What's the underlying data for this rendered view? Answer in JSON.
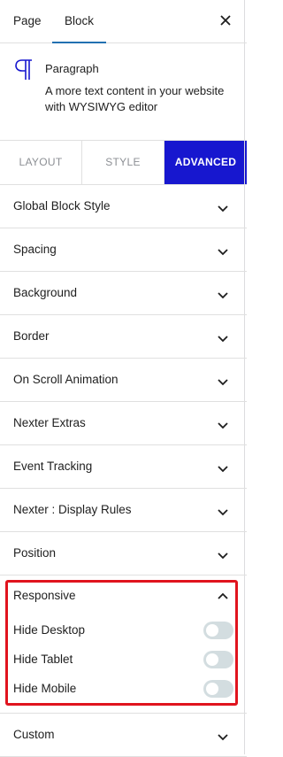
{
  "header": {
    "tab_page": "Page",
    "tab_block": "Block",
    "close_icon": "close-icon"
  },
  "block": {
    "icon": "paragraph-icon",
    "title": "Paragraph",
    "description": "A more text content in your website with WYSIWYG editor"
  },
  "modes": {
    "layout": "LAYOUT",
    "style": "STYLE",
    "advanced": "ADVANCED",
    "active": "ADVANCED"
  },
  "panels": [
    "Global Block Style",
    "Spacing",
    "Background",
    "Border",
    "On Scroll Animation",
    "Nexter Extras",
    "Event Tracking",
    "Nexter : Display Rules",
    "Position"
  ],
  "responsive": {
    "title": "Responsive",
    "toggles": [
      {
        "label": "Hide Desktop",
        "on": false
      },
      {
        "label": "Hide Tablet",
        "on": false
      },
      {
        "label": "Hide Mobile",
        "on": false
      }
    ]
  },
  "custom": {
    "title": "Custom"
  },
  "colors": {
    "accent": "#1717cf",
    "highlight": "#e0141e",
    "tab_underline": "#2271b1",
    "toggle_off": "#d3dde0"
  }
}
